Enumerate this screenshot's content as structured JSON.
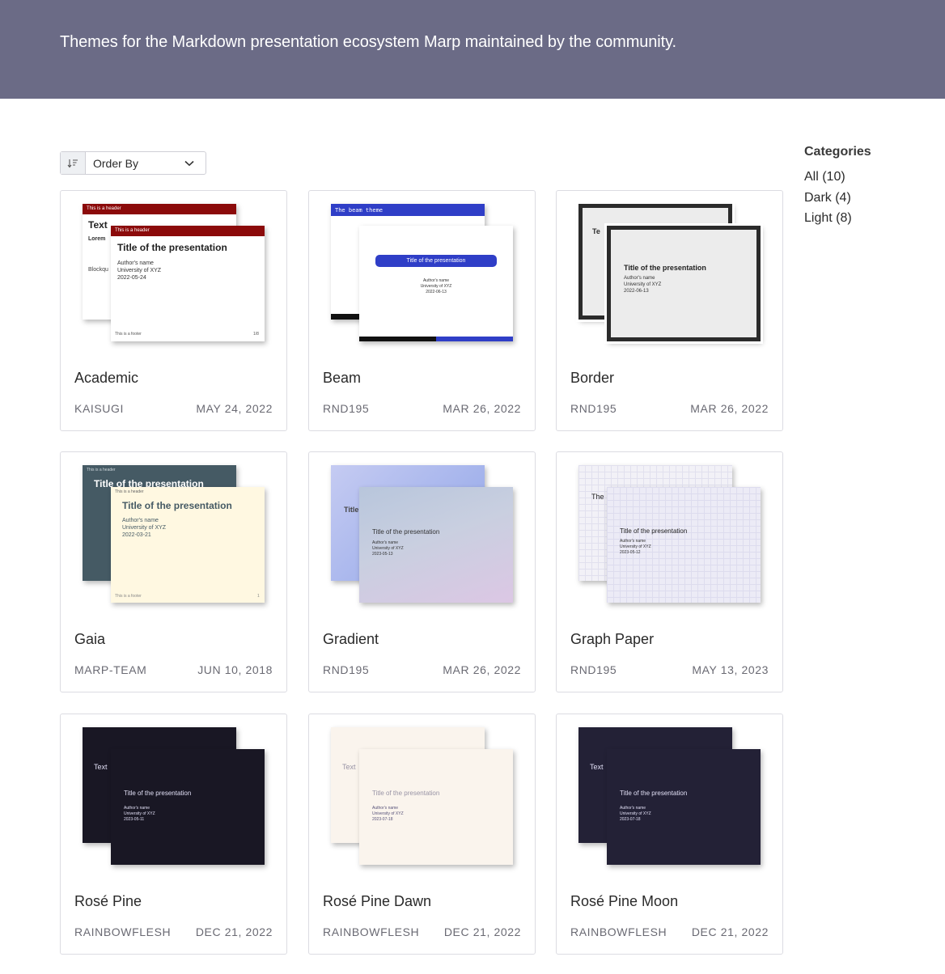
{
  "banner": {
    "text": "Themes for the Markdown presentation ecosystem Marp maintained by the community."
  },
  "toolbar": {
    "order_by_label": "Order By"
  },
  "sidebar": {
    "title": "Categories",
    "items": [
      {
        "label": "All (10)"
      },
      {
        "label": "Dark (4)"
      },
      {
        "label": "Light (8)"
      }
    ]
  },
  "cards": [
    {
      "title": "Academic",
      "author": "KAISUGI",
      "date": "MAY 24, 2022"
    },
    {
      "title": "Beam",
      "author": "RND195",
      "date": "MAR 26, 2022"
    },
    {
      "title": "Border",
      "author": "RND195",
      "date": "MAR 26, 2022"
    },
    {
      "title": "Gaia",
      "author": "MARP-TEAM",
      "date": "JUN 10, 2018"
    },
    {
      "title": "Gradient",
      "author": "RND195",
      "date": "MAR 26, 2022"
    },
    {
      "title": "Graph Paper",
      "author": "RND195",
      "date": "MAY 13, 2023"
    },
    {
      "title": "Rosé Pine",
      "author": "RAINBOWFLESH",
      "date": "DEC 21, 2022"
    },
    {
      "title": "Rosé Pine Dawn",
      "author": "RAINBOWFLESH",
      "date": "DEC 21, 2022"
    },
    {
      "title": "Rosé Pine Moon",
      "author": "RAINBOWFLESH",
      "date": "DEC 21, 2022"
    }
  ],
  "slides": {
    "academic": {
      "header": "This is a header",
      "heading": "Text",
      "title": "Title of the presentation",
      "author": "Author's name",
      "university": "University of XYZ",
      "date": "2022-05-24",
      "footer": "This is a footer",
      "page": "1/8",
      "lorem": "Lorem",
      "blockquote": "Blockqu"
    },
    "beam": {
      "header": "The beam theme",
      "title": "Title of the presentation",
      "author": "Author's name",
      "university": "University of XYZ",
      "date": "2022-06-13"
    },
    "border": {
      "title": "Title of the presentation",
      "author": "Author's name",
      "university": "University of XYZ",
      "date": "2022-06-13",
      "heading": "Te"
    },
    "gaia": {
      "header": "This is a header",
      "title": "Title of the presentation",
      "author": "Author's name",
      "university": "University of XYZ",
      "date": "2022-03-21",
      "footer": "This is a footer",
      "page": "1"
    },
    "gradient": {
      "title": "Title of the presentation",
      "author": "Author's name",
      "university": "University of XYZ",
      "date": "2023-05-13",
      "heading": "Title"
    },
    "graph": {
      "title": "Title of the presentation",
      "author": "Author's name",
      "university": "University of XYZ",
      "date": "2023-05-12",
      "heading": "The"
    },
    "rose": {
      "title": "Title of the presentation",
      "author": "Author's name",
      "university": "University of XYZ",
      "date": "2023-05-11",
      "heading": "Text"
    },
    "dawn": {
      "title": "Title of the presentation",
      "author": "Author's name",
      "university": "University of XYZ",
      "date": "2023-07-18",
      "heading": "Text"
    },
    "moon": {
      "title": "Title of the presentation",
      "author": "Author's name",
      "university": "University of XYZ",
      "date": "2023-07-18",
      "heading": "Text"
    }
  }
}
